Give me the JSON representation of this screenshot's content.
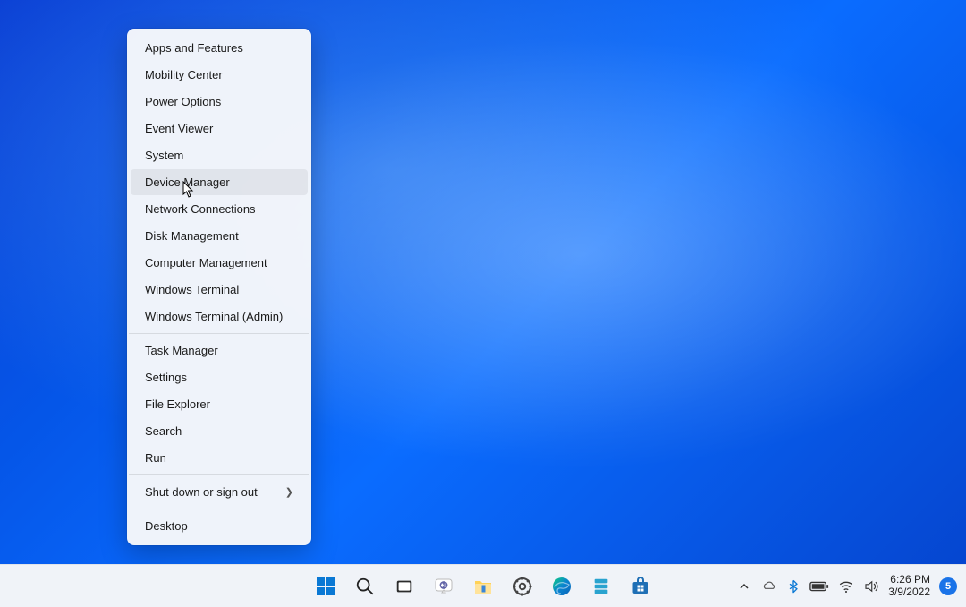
{
  "menu": {
    "group1": [
      "Apps and Features",
      "Mobility Center",
      "Power Options",
      "Event Viewer",
      "System",
      "Device Manager",
      "Network Connections",
      "Disk Management",
      "Computer Management",
      "Windows Terminal",
      "Windows Terminal (Admin)"
    ],
    "group2": [
      "Task Manager",
      "Settings",
      "File Explorer",
      "Search",
      "Run"
    ],
    "group3_submenu": "Shut down or sign out",
    "group4": [
      "Desktop"
    ],
    "hovered_index": 5
  },
  "systray": {
    "time": "6:26 PM",
    "date": "3/9/2022",
    "notif_count": "5"
  }
}
